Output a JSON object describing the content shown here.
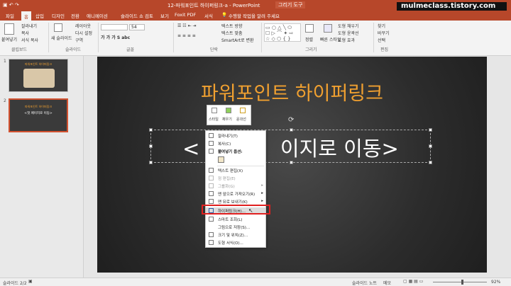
{
  "window": {
    "title": "12-파워포인트 하이퍼링크-a - PowerPoint",
    "contextual_tab": "그리기 도구",
    "watermark": "mulmeclass.tistory.com",
    "watermark_logo": "Mc"
  },
  "tabs": [
    "파일",
    "홈",
    "삽입",
    "디자인",
    "전환",
    "애니메이션",
    "슬라이드 쇼",
    "검토",
    "보기",
    "Foxit PDF",
    "서식"
  ],
  "active_tab": "홈",
  "tell_me": "수행할 작업을 알려 주세요",
  "ribbon": {
    "groups": [
      "클립보드",
      "슬라이드",
      "글꼴",
      "단락",
      "그리기",
      "편집"
    ],
    "clipboard": {
      "paste": "붙여넣기",
      "cut": "잘라내기",
      "copy": "복사",
      "format": "서식 복사"
    },
    "slides": {
      "new": "새 슬라이드",
      "layout": "레이아웃",
      "reset": "다시 설정",
      "section": "구역"
    },
    "font_size": "54",
    "paragraph": {
      "direction": "텍스트 방향",
      "align": "텍스트 맞춤",
      "smartart": "SmartArt로 변환"
    },
    "drawing": {
      "arrange": "정렬",
      "styles": "빠른 스타일",
      "fill": "도형 채우기",
      "outline": "도형 윤곽선",
      "effects": "도형 효과"
    },
    "editing": {
      "find": "찾기",
      "replace": "바꾸기",
      "select": "선택"
    }
  },
  "thumbnails": [
    {
      "num": "1",
      "title": "파워포인트 하이퍼링크"
    },
    {
      "num": "2",
      "title": "파워포인트 하이퍼링크",
      "text": "<첫 페이지로 이동>"
    }
  ],
  "slide": {
    "title": "파워포인트 하이퍼링크",
    "text_left": "<",
    "text_right": "이지로 이동>"
  },
  "mini_toolbar": [
    "스타일",
    "채우기",
    "윤곽선"
  ],
  "context_menu": [
    {
      "label": "잘라내기(T)",
      "disabled": false
    },
    {
      "label": "복사(C)",
      "disabled": false
    },
    {
      "label": "붙여넣기 옵션:",
      "disabled": false,
      "bold": true
    },
    {
      "label": "",
      "disabled": false,
      "paste_icon": true
    },
    {
      "label": "텍스트 편집(X)",
      "disabled": false
    },
    {
      "label": "점 편집(E)",
      "disabled": true
    },
    {
      "label": "그룹화(G)",
      "disabled": true,
      "submenu": true
    },
    {
      "label": "맨 앞으로 가져오기(R)",
      "disabled": false,
      "submenu": true
    },
    {
      "label": "맨 뒤로 보내기(K)",
      "disabled": false,
      "submenu": true
    },
    {
      "label": "하이퍼링크(H)...",
      "disabled": false,
      "highlight": true
    },
    {
      "label": "스마트 조회(L)",
      "disabled": false
    },
    {
      "label": "그림으로 저장(S)...",
      "disabled": false
    },
    {
      "label": "크기 및 위치(Z)...",
      "disabled": false
    },
    {
      "label": "도형 서식(O)...",
      "disabled": false
    }
  ],
  "status": {
    "slide": "슬라이드 2/2",
    "notes": "슬라이드 노트",
    "comments": "메모",
    "zoom": "92%"
  },
  "colors": {
    "accent": "#b7472a",
    "title": "#f0a030",
    "highlight": "#e02020"
  }
}
